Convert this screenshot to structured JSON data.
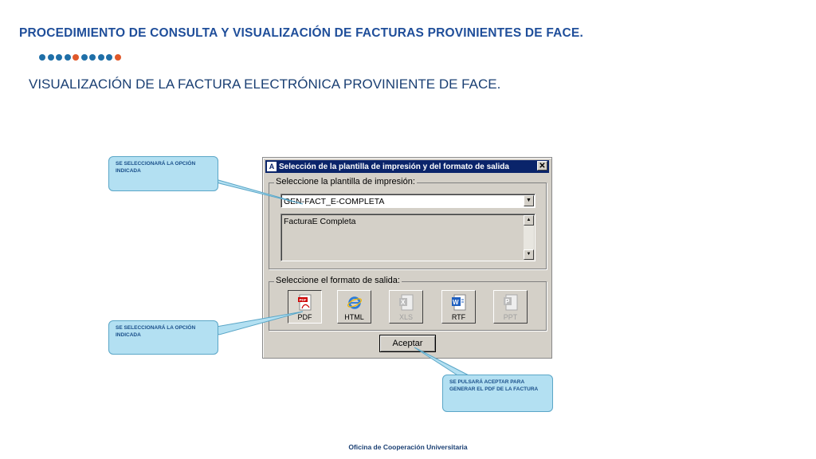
{
  "header": {
    "title": "PROCEDIMIENTO DE CONSULTA Y VISUALIZACIÓN DE FACTURAS PROVINIENTES DE FACE.",
    "subtitle": "VISUALIZACIÓN DE LA FACTURA ELECTRÓNICA PROVINIENTE DE FACE.",
    "dot_colors": [
      "#1f6fa8",
      "#1f6fa8",
      "#1f6fa8",
      "#1f6fa8",
      "#e0582a",
      "#1f6fa8",
      "#1f6fa8",
      "#1f6fa8",
      "#1f6fa8",
      "#e0582a"
    ]
  },
  "dialog": {
    "title": "Selección de la plantilla de impresión y del formato de salida",
    "app_icon_letter": "A",
    "close_glyph": "✕",
    "template_group_label": "Seleccione la plantilla de impresión:",
    "template_value": "GEN-FACT_E-COMPLETA",
    "description": "FacturaE Completa",
    "format_group_label": "Seleccione el formato de salida:",
    "formats": [
      {
        "label": "PDF",
        "icon": "pdf-icon",
        "enabled": true,
        "selected": true
      },
      {
        "label": "HTML",
        "icon": "internet-explorer-icon",
        "enabled": true,
        "selected": false
      },
      {
        "label": "XLS",
        "icon": "excel-icon",
        "enabled": false,
        "selected": false
      },
      {
        "label": "RTF",
        "icon": "word-icon",
        "enabled": true,
        "selected": false
      },
      {
        "label": "PPT",
        "icon": "powerpoint-icon",
        "enabled": false,
        "selected": false
      }
    ],
    "accept_label": "Aceptar"
  },
  "callouts": {
    "template_note": "SE SELECCIONARÁ LA OPCIÓN INDICADA",
    "format_note": "SE SELECCIONARÁ LA OPCIÓN INDICADA",
    "accept_note": "SE PULSARÁ ACEPTAR PARA GENERAR EL PDF DE LA FACTURA"
  },
  "footer": {
    "text": "Oficina de Cooperación Universitaria"
  }
}
